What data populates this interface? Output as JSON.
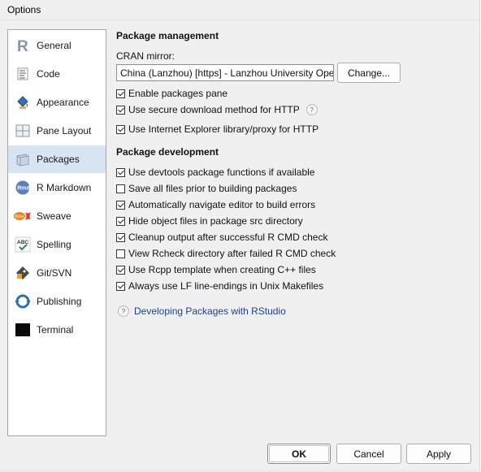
{
  "window": {
    "title": "Options"
  },
  "sidebar": {
    "items": [
      {
        "label": "General",
        "icon": "r-logo-icon"
      },
      {
        "label": "Code",
        "icon": "code-document-icon"
      },
      {
        "label": "Appearance",
        "icon": "paint-bucket-icon"
      },
      {
        "label": "Pane Layout",
        "icon": "pane-layout-icon"
      },
      {
        "label": "Packages",
        "icon": "package-icon",
        "selected": true
      },
      {
        "label": "R Markdown",
        "icon": "rmd-icon"
      },
      {
        "label": "Sweave",
        "icon": "sweave-icon"
      },
      {
        "label": "Spelling",
        "icon": "spellcheck-icon"
      },
      {
        "label": "Git/SVN",
        "icon": "git-icon"
      },
      {
        "label": "Publishing",
        "icon": "publish-icon"
      },
      {
        "label": "Terminal",
        "icon": "terminal-icon"
      }
    ]
  },
  "package_management": {
    "title": "Package management",
    "cran_label": "CRAN mirror:",
    "cran_value": "China (Lanzhou) [https] - Lanzhou University Open",
    "change_label": "Change...",
    "options": [
      {
        "label": "Enable packages pane",
        "checked": true
      },
      {
        "label": "Use secure download method for HTTP",
        "checked": true,
        "help": "?"
      },
      {
        "label": "Use Internet Explorer library/proxy for HTTP",
        "checked": true
      }
    ]
  },
  "package_development": {
    "title": "Package development",
    "options": [
      {
        "label": "Use devtools package functions if available",
        "checked": true
      },
      {
        "label": "Save all files prior to building packages",
        "checked": false
      },
      {
        "label": "Automatically navigate editor to build errors",
        "checked": true
      },
      {
        "label": "Hide object files in package src directory",
        "checked": true
      },
      {
        "label": "Cleanup output after successful R CMD check",
        "checked": true
      },
      {
        "label": "View Rcheck directory after failed R CMD check",
        "checked": false
      },
      {
        "label": "Use Rcpp template when creating C++ files",
        "checked": true
      },
      {
        "label": "Always use LF line-endings in Unix Makefiles",
        "checked": true
      }
    ],
    "help_link": "Developing Packages with RStudio",
    "help_glyph": "?"
  },
  "buttons": {
    "ok": "OK",
    "cancel": "Cancel",
    "apply": "Apply"
  }
}
